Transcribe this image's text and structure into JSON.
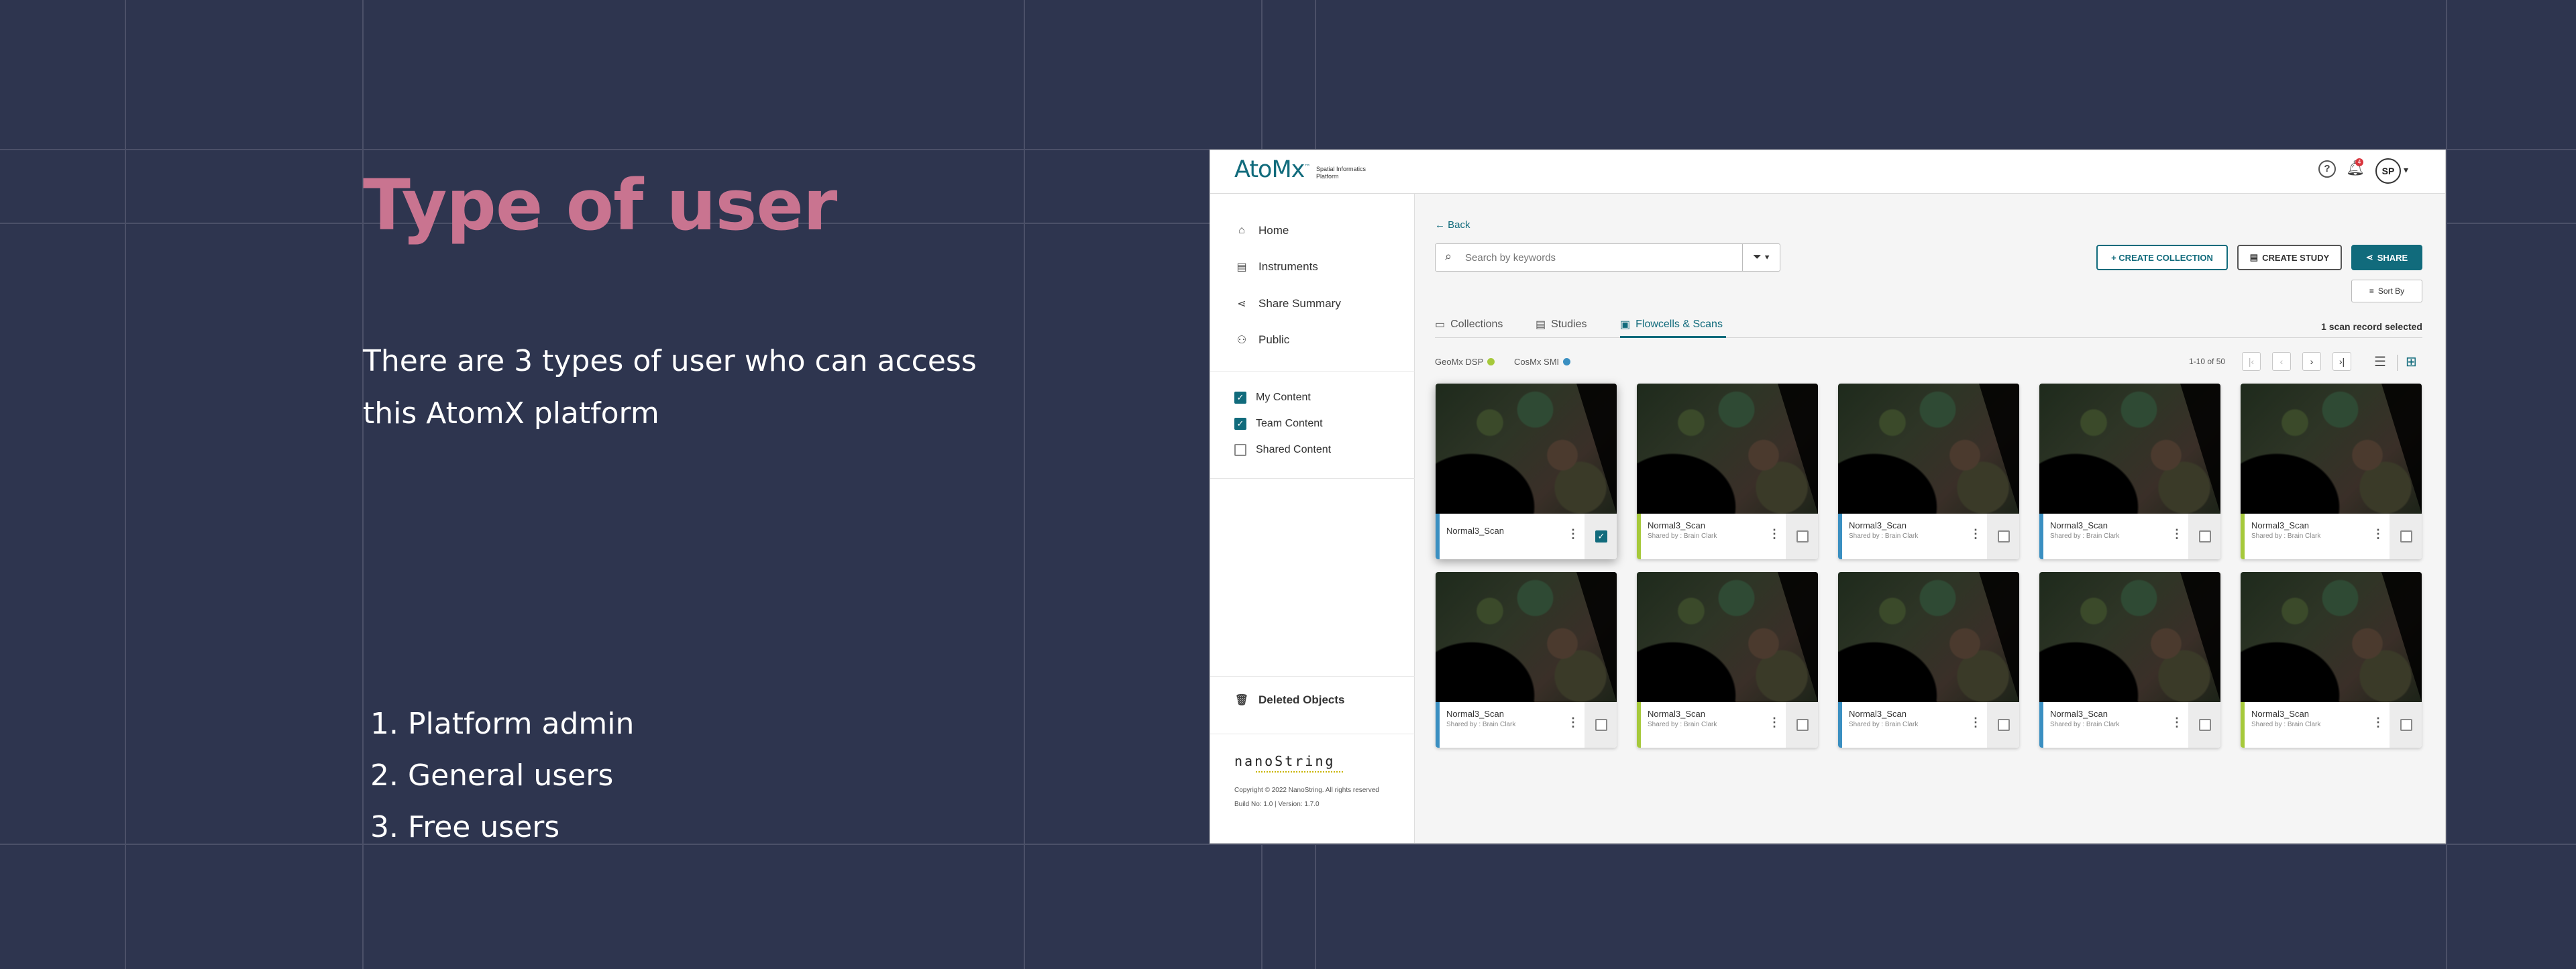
{
  "slide": {
    "title": "Type of user",
    "intro": "There are 3 types of user who can access this AtomX platform",
    "user_types": [
      "1. Platform admin",
      "2. General users",
      "3. Free users"
    ]
  },
  "app": {
    "header": {
      "logo": "AtoMx",
      "logo_trademark": "™",
      "logo_subtitle": "Spatial Informatics Platform",
      "help_icon": "?",
      "notification_count": "4",
      "avatar_initials": "SP"
    },
    "sidebar": {
      "nav": [
        "Home",
        "Instruments",
        "Share Summary",
        "Public"
      ],
      "filters": [
        {
          "label": "My Content",
          "checked": true
        },
        {
          "label": "Team Content",
          "checked": true
        },
        {
          "label": "Shared Content",
          "checked": false
        }
      ],
      "deleted": "Deleted Objects",
      "brand": "nanoString",
      "copyright": "Copyright © 2022 NanoString. All rights reserved",
      "build": "Build No: 1.0   |   Version: 1.7.0"
    },
    "main": {
      "back": "← Back",
      "search_placeholder": "Search by keywords",
      "buttons": {
        "create_collection": "+  CREATE COLLECTION",
        "create_study": "CREATE STUDY",
        "share": "SHARE"
      },
      "sort_by": "Sort By",
      "tabs": [
        "Collections",
        "Studies",
        "Flowcells & Scans"
      ],
      "active_tab": "Flowcells & Scans",
      "selected_note": "1 scan record selected",
      "legend": [
        {
          "label": "GeoMx DSP",
          "color": "#a6c93b"
        },
        {
          "label": "CosMx SMI",
          "color": "#3a8fc1"
        }
      ],
      "pagination": "1-10 of 50",
      "pager_buttons": [
        "|‹",
        "‹",
        "›",
        "›|"
      ],
      "view_icons": [
        "list-view-icon",
        "grid-view-icon"
      ],
      "cards": [
        {
          "name": "Normal3_Scan",
          "shared": "",
          "type": "CosMx SMI",
          "checked": true
        },
        {
          "name": "Normal3_Scan",
          "shared": "Shared by : Brain Clark",
          "type": "GeoMx DSP",
          "checked": false
        },
        {
          "name": "Normal3_Scan",
          "shared": "Shared by : Brain Clark",
          "type": "CosMx SMI",
          "checked": false
        },
        {
          "name": "Normal3_Scan",
          "shared": "Shared by : Brain Clark",
          "type": "CosMx SMI",
          "checked": false
        },
        {
          "name": "Normal3_Scan",
          "shared": "Shared by : Brain Clark",
          "type": "GeoMx DSP",
          "checked": false
        },
        {
          "name": "Normal3_Scan",
          "shared": "Shared by : Brain Clark",
          "type": "CosMx SMI",
          "checked": false
        },
        {
          "name": "Normal3_Scan",
          "shared": "Shared by : Brain Clark",
          "type": "GeoMx DSP",
          "checked": false
        },
        {
          "name": "Normal3_Scan",
          "shared": "Shared by : Brain Clark",
          "type": "CosMx SMI",
          "checked": false
        },
        {
          "name": "Normal3_Scan",
          "shared": "Shared by : Brain Clark",
          "type": "CosMx SMI",
          "checked": false
        },
        {
          "name": "Normal3_Scan",
          "shared": "Shared by : Brain Clark",
          "type": "GeoMx DSP",
          "checked": false
        }
      ]
    }
  },
  "colors": {
    "background": "#2e354f",
    "title": "#c97490",
    "accent": "#116b7c"
  }
}
